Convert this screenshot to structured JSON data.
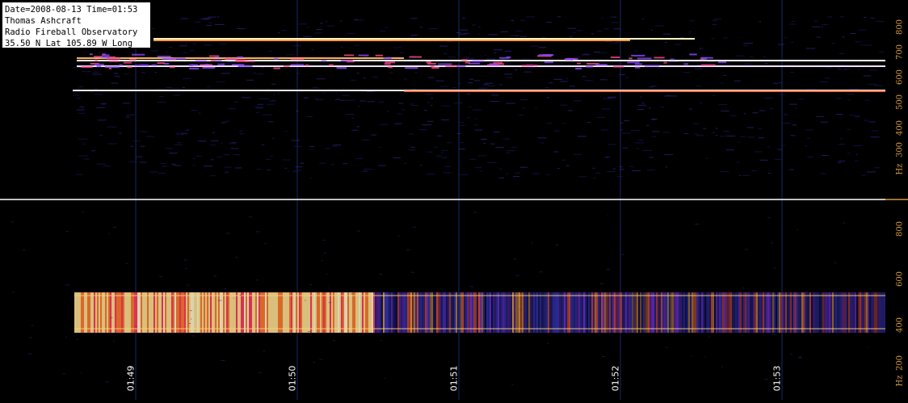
{
  "header_info": {
    "line1": "Date=2008-08-13 Time=01:53",
    "line2": "Thomas Ashcraft",
    "line3": "Radio Fireball Observatory",
    "line4": "35.50 N Lat  105.89 W Long"
  },
  "top_scale": {
    "labels": [
      "800",
      "700",
      "600",
      "500",
      "400",
      "300",
      "Hz"
    ]
  },
  "bottom_scale": {
    "labels": [
      "800",
      "600",
      "400",
      "200",
      "Hz"
    ]
  },
  "time_axis": {
    "labels": [
      "01:49",
      "01:50",
      "01:51",
      "01:52",
      "01:53"
    ]
  },
  "colors": {
    "background": "#000000",
    "divider": "#ffffff",
    "scale_text": "#d49a3a",
    "time_grid": "#0d1a3a"
  }
}
